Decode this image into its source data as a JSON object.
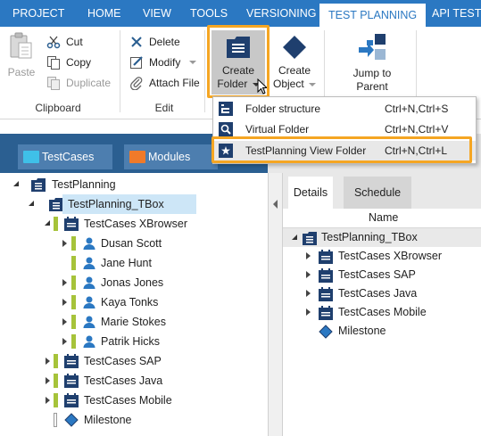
{
  "menu": {
    "tabs": [
      {
        "label": "PROJECT"
      },
      {
        "label": "HOME"
      },
      {
        "label": "VIEW"
      },
      {
        "label": "TOOLS"
      },
      {
        "label": "VERSIONING"
      },
      {
        "label": "TEST PLANNING"
      },
      {
        "label": "API TESTIN"
      }
    ],
    "active_index": 5
  },
  "ribbon": {
    "clipboard": {
      "paste": "Paste",
      "cut": "Cut",
      "copy": "Copy",
      "duplicate": "Duplicate",
      "group_label": "Clipboard"
    },
    "edit": {
      "delete": "Delete",
      "modify": "Modify",
      "attach_file": "Attach File",
      "group_label": "Edit"
    },
    "create": {
      "create_folder_line1": "Create",
      "create_folder_line2": "Folder",
      "create_object_line1": "Create",
      "create_object_line2": "Object"
    },
    "jump": {
      "line1": "Jump to",
      "line2": "Parent"
    }
  },
  "dropdown": {
    "items": [
      {
        "label": "Folder structure",
        "shortcut": "Ctrl+N,Ctrl+S",
        "icon": "folder-structure-icon"
      },
      {
        "label": "Virtual Folder",
        "shortcut": "Ctrl+N,Ctrl+V",
        "icon": "virtual-folder-icon"
      },
      {
        "label": "TestPlanning View Folder",
        "shortcut": "Ctrl+N,Ctrl+L",
        "icon": "testplanning-view-folder-icon"
      }
    ]
  },
  "explorer": {
    "tabs": [
      {
        "label": "TestCases",
        "color": "#3fc0e8"
      },
      {
        "label": "Modules",
        "color": "#f07a2a"
      }
    ]
  },
  "tree": {
    "root": "TestPlanning",
    "tbox": "TestPlanning_TBox",
    "xbrowser": "TestCases XBrowser",
    "users": [
      "Dusan Scott",
      "Jane Hunt",
      "Jonas Jones",
      "Kaya Tonks",
      "Marie Stokes",
      "Patrik Hicks"
    ],
    "sap": "TestCases SAP",
    "java": "TestCases Java",
    "mobile": "TestCases Mobile",
    "milestone": "Milestone"
  },
  "details": {
    "tabs": [
      "Details",
      "Schedule"
    ],
    "column": "Name",
    "rows": [
      "TestPlanning_TBox",
      "TestCases XBrowser",
      "TestCases SAP",
      "TestCases Java",
      "TestCases Mobile",
      "Milestone"
    ]
  },
  "colors": {
    "accent_blue": "#2b78c2",
    "highlight_orange": "#f5a623",
    "folder_navy": "#1f3f6e",
    "status_green": "#a6c33a"
  }
}
